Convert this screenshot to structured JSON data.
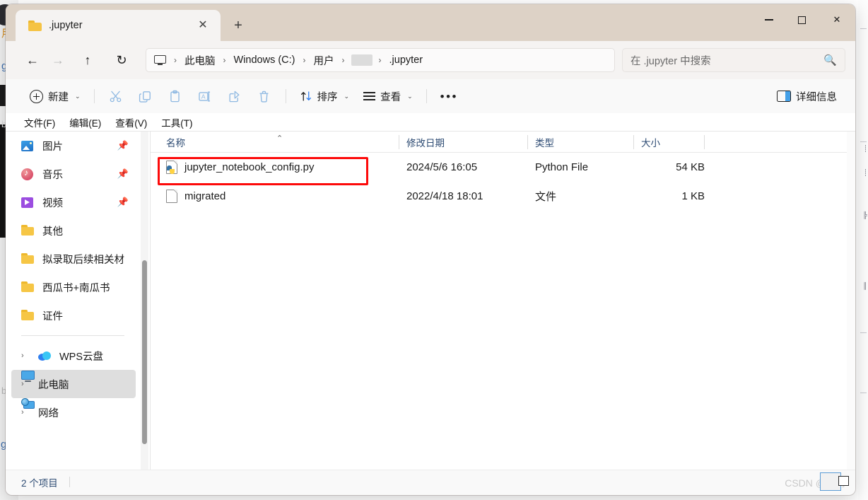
{
  "window": {
    "tab_title": ".jupyter",
    "tab_icon": "folder-icon",
    "close_tab_glyph": "✕",
    "new_tab_glyph": "+",
    "minimize_label": "—",
    "maximize_label": "□",
    "close_label": "✕"
  },
  "nav": {
    "back_glyph": "←",
    "forward_glyph": "→",
    "up_glyph": "↑",
    "refresh_glyph": "↻",
    "breadcrumb": [
      {
        "label": "",
        "icon": "monitor-icon",
        "type": "icon"
      },
      {
        "label": "此电脑",
        "type": "text"
      },
      {
        "label": "Windows (C:)",
        "type": "text"
      },
      {
        "label": "用户",
        "type": "text"
      },
      {
        "label": "",
        "type": "redacted"
      },
      {
        "label": ".jupyter",
        "type": "text"
      }
    ],
    "separator": "›"
  },
  "search": {
    "placeholder": "在 .jupyter 中搜索",
    "icon": "search-icon"
  },
  "toolbar": {
    "new_label": "新建",
    "cut_icon": "scissors-icon",
    "copy_icon": "copy-icon",
    "paste_icon": "clipboard-icon",
    "rename_icon": "rename-icon",
    "share_icon": "share-icon",
    "delete_icon": "trash-icon",
    "sort_label": "排序",
    "sort_icon": "sort-arrows-icon",
    "view_label": "查看",
    "view_icon": "list-icon",
    "more_label": "•••",
    "details_label": "详细信息",
    "details_icon": "details-pane-icon",
    "caret": "⌄"
  },
  "menubar": {
    "items": [
      {
        "label": "文件(F)"
      },
      {
        "label": "编辑(E)"
      },
      {
        "label": "查看(V)"
      },
      {
        "label": "工具(T)"
      }
    ]
  },
  "sidebar": {
    "items": [
      {
        "label": "图片",
        "icon": "pictures-icon",
        "pinned": true,
        "chevron": false
      },
      {
        "label": "音乐",
        "icon": "music-icon",
        "pinned": true,
        "chevron": false
      },
      {
        "label": "视频",
        "icon": "video-icon",
        "pinned": true,
        "chevron": false
      },
      {
        "label": "其他",
        "icon": "folder-icon",
        "pinned": false,
        "chevron": false
      },
      {
        "label": "拟录取后续相关材",
        "icon": "folder-icon",
        "pinned": false,
        "chevron": false
      },
      {
        "label": "西瓜书+南瓜书",
        "icon": "folder-icon",
        "pinned": false,
        "chevron": false
      },
      {
        "label": "证件",
        "icon": "folder-icon",
        "pinned": false,
        "chevron": false
      }
    ],
    "tree": [
      {
        "label": "WPS云盘",
        "icon": "cloud-icon",
        "selected": false
      },
      {
        "label": "此电脑",
        "icon": "this-pc-icon",
        "selected": true
      },
      {
        "label": "网络",
        "icon": "network-icon",
        "selected": false
      }
    ],
    "chevron": "›",
    "pin_glyph": "📌"
  },
  "file_list": {
    "columns": [
      {
        "label": "名称",
        "sorted": "asc"
      },
      {
        "label": "修改日期"
      },
      {
        "label": "类型"
      },
      {
        "label": "大小"
      }
    ],
    "sort_caret": "⌃",
    "rows": [
      {
        "name": "jupyter_notebook_config.py",
        "date": "2024/5/6 16:05",
        "type": "Python File",
        "size": "54 KB",
        "icon": "python-file-icon",
        "annotated": true
      },
      {
        "name": "migrated",
        "date": "2022/4/18 18:01",
        "type": "文件",
        "size": "1 KB",
        "icon": "generic-file-icon",
        "annotated": false
      }
    ]
  },
  "statusbar": {
    "item_count": "2 个项目"
  },
  "watermark": {
    "text": "CSDN @绿树"
  },
  "colors": {
    "titlebar": "#ddd2c6",
    "accent_blue": "#2d4b73",
    "annotation_red": "#fd0a0a",
    "selection_gray": "#dedede",
    "folder_yellow": "#f6c645"
  },
  "background_windows": {
    "left_glyphs": [
      "用",
      "g",
      "bk",
      "b",
      "g"
    ],
    "right_marks": [
      "┊",
      "┊",
      "╠",
      "║"
    ]
  }
}
